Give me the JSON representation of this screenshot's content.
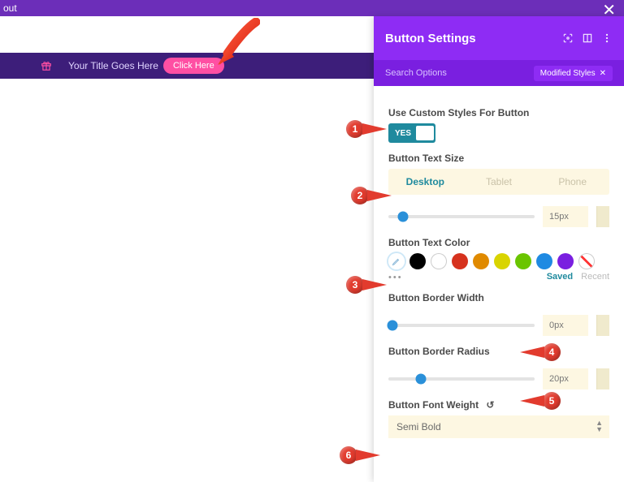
{
  "topbar": {
    "fragment": "out"
  },
  "promo": {
    "title": "Your Title Goes Here",
    "button": "Click Here"
  },
  "panel": {
    "title": "Button Settings",
    "search_placeholder": "Search Options",
    "modified_chip": "Modified Styles"
  },
  "settings": {
    "custom_styles": {
      "label": "Use Custom Styles For Button",
      "value": "YES"
    },
    "text_size": {
      "label": "Button Text Size",
      "tabs": {
        "desktop": "Desktop",
        "tablet": "Tablet",
        "phone": "Phone"
      },
      "value": "15px",
      "slider_pct": 10
    },
    "text_color": {
      "label": "Button Text Color",
      "swatches": [
        "picker",
        "#000000",
        "#ffffff",
        "#d6321e",
        "#e08a00",
        "#dадаI盐",
        "#6ac500",
        "#1f8ae2",
        "#7a1fe0",
        "none"
      ],
      "saved": "Saved",
      "recent": "Recent",
      "more": "•••"
    },
    "border_width": {
      "label": "Button Border Width",
      "value": "0px",
      "slider_pct": 3
    },
    "border_radius": {
      "label": "Button Border Radius",
      "value": "20px",
      "slider_pct": 22
    },
    "font_weight": {
      "label": "Button Font Weight",
      "value": "Semi Bold"
    }
  },
  "markers": [
    "1",
    "2",
    "3",
    "4",
    "5",
    "6"
  ]
}
